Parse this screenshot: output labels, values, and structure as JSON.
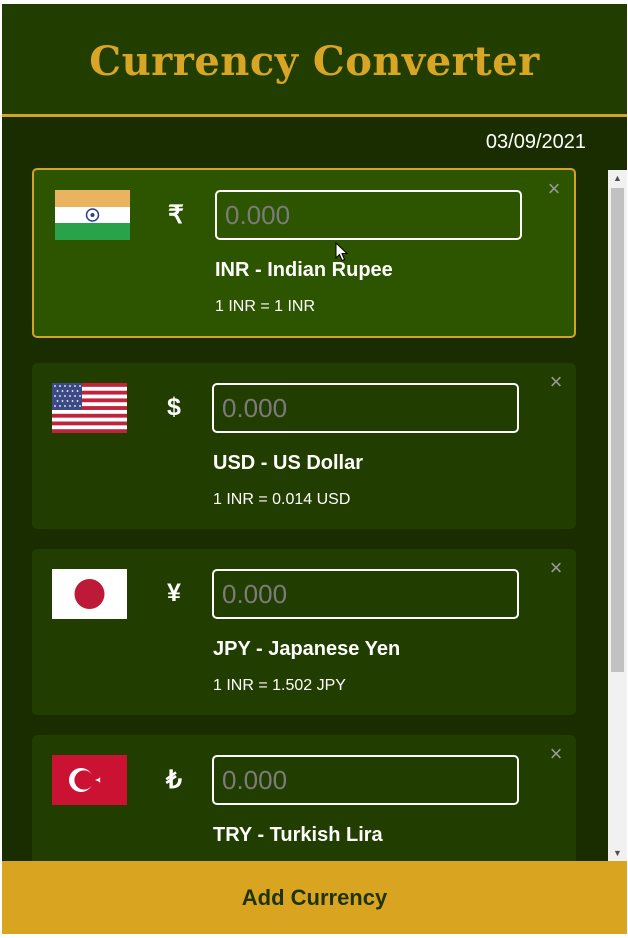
{
  "app": {
    "title": "Currency Converter",
    "date": "03/09/2021"
  },
  "colors": {
    "accent": "#d9a524",
    "background": "#1a2d00",
    "card": "#213d00",
    "active_card": "#2d5500"
  },
  "currencies": [
    {
      "flag": "india-flag-icon",
      "symbol": "₹",
      "placeholder": "0.000",
      "name": "INR - Indian Rupee",
      "rate": "1 INR = 1 INR",
      "close": "×",
      "active": true
    },
    {
      "flag": "usa-flag-icon",
      "symbol": "$",
      "placeholder": "0.000",
      "name": "USD - US Dollar",
      "rate": "1 INR = 0.014 USD",
      "close": "×",
      "active": false
    },
    {
      "flag": "japan-flag-icon",
      "symbol": "¥",
      "placeholder": "0.000",
      "name": "JPY - Japanese Yen",
      "rate": "1 INR = 1.502 JPY",
      "close": "×",
      "active": false
    },
    {
      "flag": "turkey-flag-icon",
      "symbol": "₺",
      "placeholder": "0.000",
      "name": "TRY - Turkish Lira",
      "rate": "",
      "close": "×",
      "active": false
    }
  ],
  "scrollbar": {
    "up_arrow": "▲",
    "down_arrow": "▼"
  },
  "footer": {
    "add_label": "Add Currency"
  }
}
